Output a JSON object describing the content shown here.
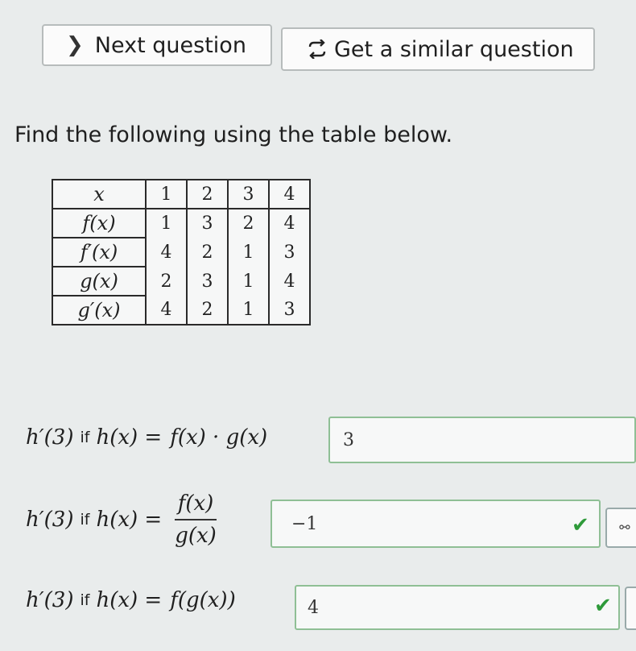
{
  "nav": {
    "next_label": "Next question",
    "similar_label": "Get a similar question",
    "next_icon": "chevron-right-icon",
    "similar_icon": "cycle-arrows-icon"
  },
  "instructions": "Find the following using the table below.",
  "table": {
    "header": {
      "label": "x",
      "values": [
        "1",
        "2",
        "3",
        "4"
      ]
    },
    "rows": [
      {
        "label": "f(x)",
        "values": [
          "1",
          "3",
          "2",
          "4"
        ]
      },
      {
        "label": "f′(x)",
        "values": [
          "4",
          "2",
          "1",
          "3"
        ]
      },
      {
        "label": "g(x)",
        "values": [
          "2",
          "3",
          "1",
          "4"
        ]
      },
      {
        "label": "g′(x)",
        "values": [
          "4",
          "2",
          "1",
          "3"
        ]
      }
    ]
  },
  "questions": [
    {
      "lhs": "h′(3)",
      "if": "if",
      "hx": "h(x) =",
      "expr": "f(x) · g(x)",
      "answer": "3"
    },
    {
      "lhs": "h′(3)",
      "if": "if",
      "hx": "h(x) =",
      "num": "f(x)",
      "den": "g(x)",
      "answer": "−1"
    },
    {
      "lhs": "h′(3)",
      "if": "if",
      "hx": "h(x) =",
      "expr": "f(g(x))",
      "answer": "4"
    }
  ],
  "colors": {
    "correct": "#2e9a3a",
    "box_border": "#8fbf95"
  }
}
